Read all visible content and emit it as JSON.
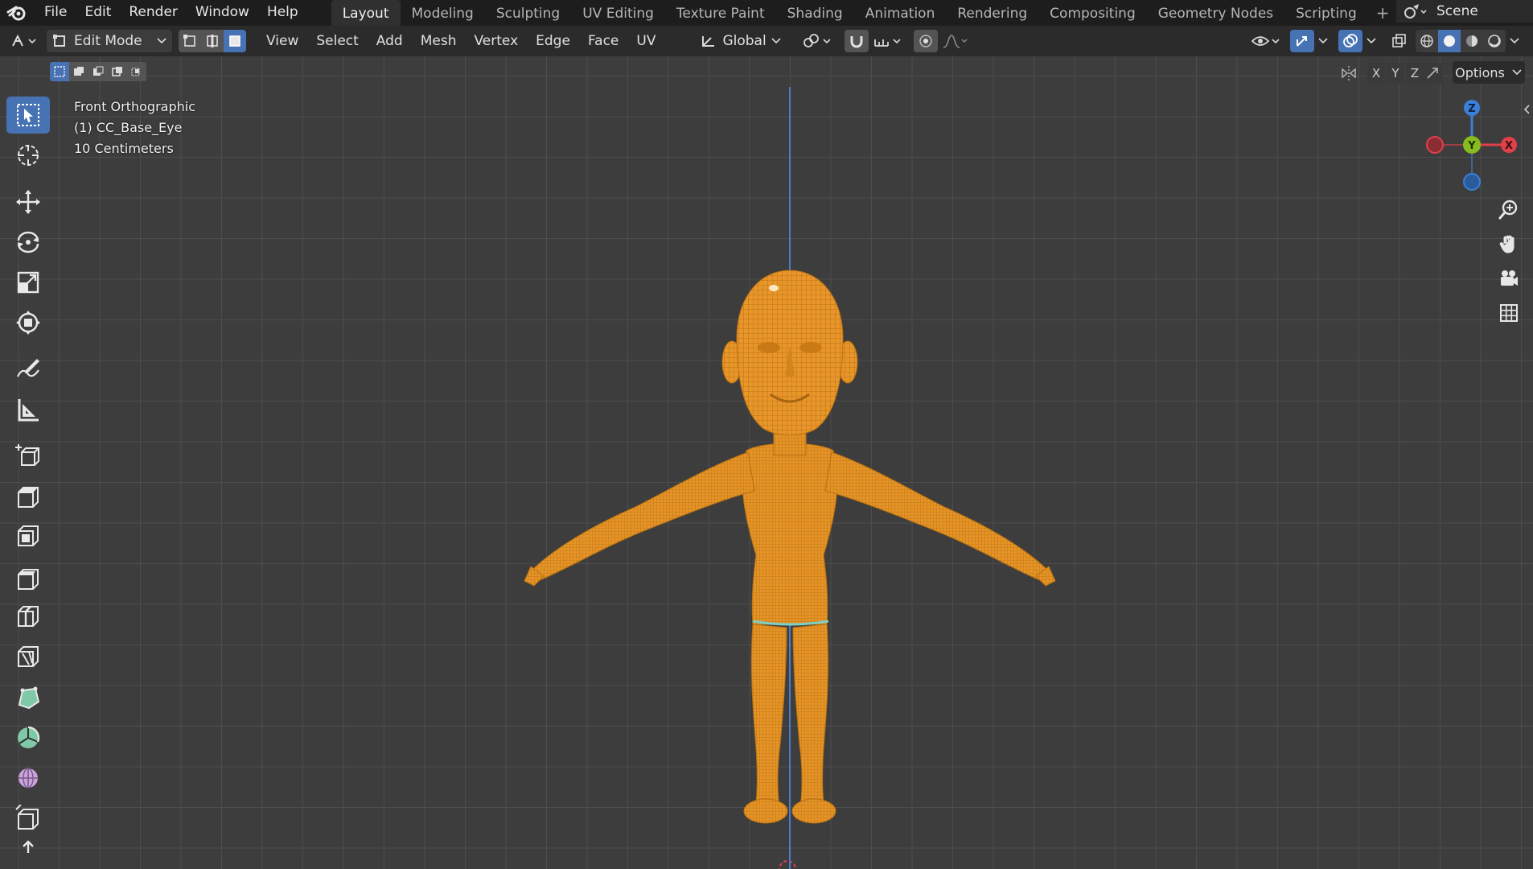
{
  "topbar": {
    "menus": [
      "File",
      "Edit",
      "Render",
      "Window",
      "Help"
    ],
    "workspaces": [
      "Layout",
      "Modeling",
      "Sculpting",
      "UV Editing",
      "Texture Paint",
      "Shading",
      "Animation",
      "Rendering",
      "Compositing",
      "Geometry Nodes",
      "Scripting"
    ],
    "active_workspace": "Layout",
    "add_label": "+",
    "scene_label": "Scene"
  },
  "header": {
    "mode": "Edit Mode",
    "menus": [
      "View",
      "Select",
      "Add",
      "Mesh",
      "Vertex",
      "Edge",
      "Face",
      "UV"
    ],
    "orientation": "Global",
    "active_select_mode": "face"
  },
  "viewport": {
    "view_name": "Front Orthographic",
    "object_name": "(1) CC_Base_Eye",
    "scale_label": "10 Centimeters",
    "options_label": "Options",
    "axis_toggles": [
      "X",
      "Y",
      "Z"
    ],
    "gizmo_labels": {
      "z": "Z",
      "y": "Y",
      "x": "X"
    }
  },
  "colors": {
    "accent": "#4772b3",
    "mesh_fill": "#e8962a",
    "mesh_wire": "#b06a10",
    "axis_x": "#e0404a",
    "axis_y": "#86bc20",
    "axis_z": "#3a80d8"
  },
  "tools": [
    "select-box-icon",
    "cursor-icon",
    "move-icon",
    "rotate-icon",
    "scale-icon",
    "transform-icon",
    "annotate-icon",
    "measure-icon",
    "add-cube-icon",
    "extrude-icon",
    "inset-icon",
    "bevel-icon",
    "loop-cut-icon",
    "knife-icon",
    "poly-build-icon",
    "spin-icon",
    "smooth-icon",
    "edge-slide-icon",
    "shrink-icon"
  ]
}
